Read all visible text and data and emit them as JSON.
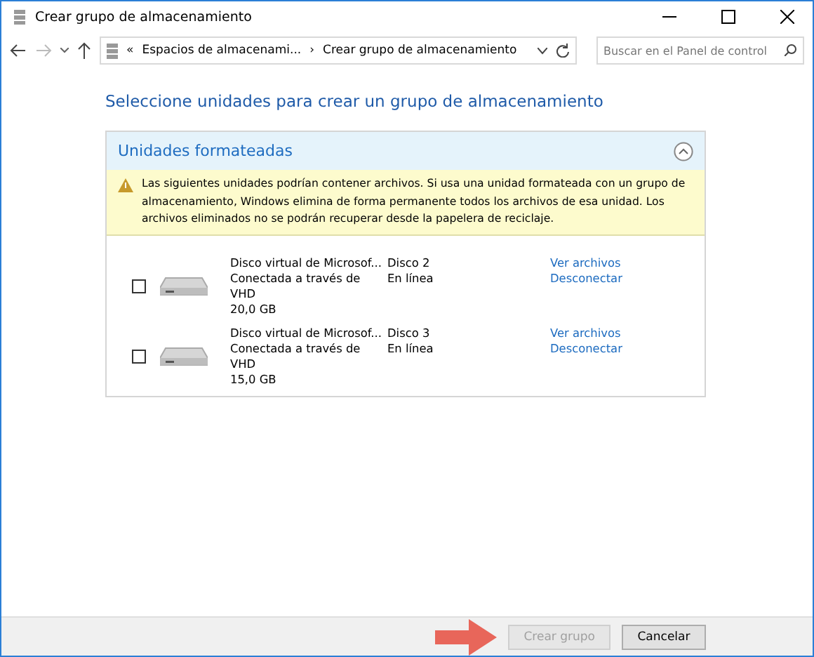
{
  "window": {
    "title": "Crear grupo de almacenamiento"
  },
  "address_bar": {
    "crumbs": [
      "«",
      "Espacios de almacenami...",
      "›",
      "Crear grupo de almacenamiento"
    ]
  },
  "search": {
    "placeholder": "Buscar en el Panel de control"
  },
  "heading": "Seleccione unidades para crear un grupo de almacenamiento",
  "panel": {
    "title": "Unidades formateadas",
    "expanded": true,
    "warning": "Las siguientes unidades podrían contener archivos. Si usa una unidad formateada con un grupo de almacenamiento, Windows elimina de forma permanente todos los archivos de esa unidad. Los archivos eliminados no se podrán recuperar desde la papelera de reciclaje.",
    "drives": [
      {
        "checked": false,
        "name": "Disco virtual de Microsof...",
        "connection": "Conectada a través de",
        "type": "VHD",
        "size": "20,0 GB",
        "disk": "Disco 2",
        "status": "En línea",
        "links": [
          "Ver archivos",
          "Desconectar"
        ]
      },
      {
        "checked": false,
        "name": "Disco virtual de Microsof...",
        "connection": "Conectada a través de",
        "type": "VHD",
        "size": "15,0 GB",
        "disk": "Disco 3",
        "status": "En línea",
        "links": [
          "Ver archivos",
          "Desconectar"
        ]
      }
    ]
  },
  "buttons": [
    {
      "label": "Crear grupo",
      "disabled": true
    },
    {
      "label": "Cancelar",
      "disabled": false
    }
  ]
}
